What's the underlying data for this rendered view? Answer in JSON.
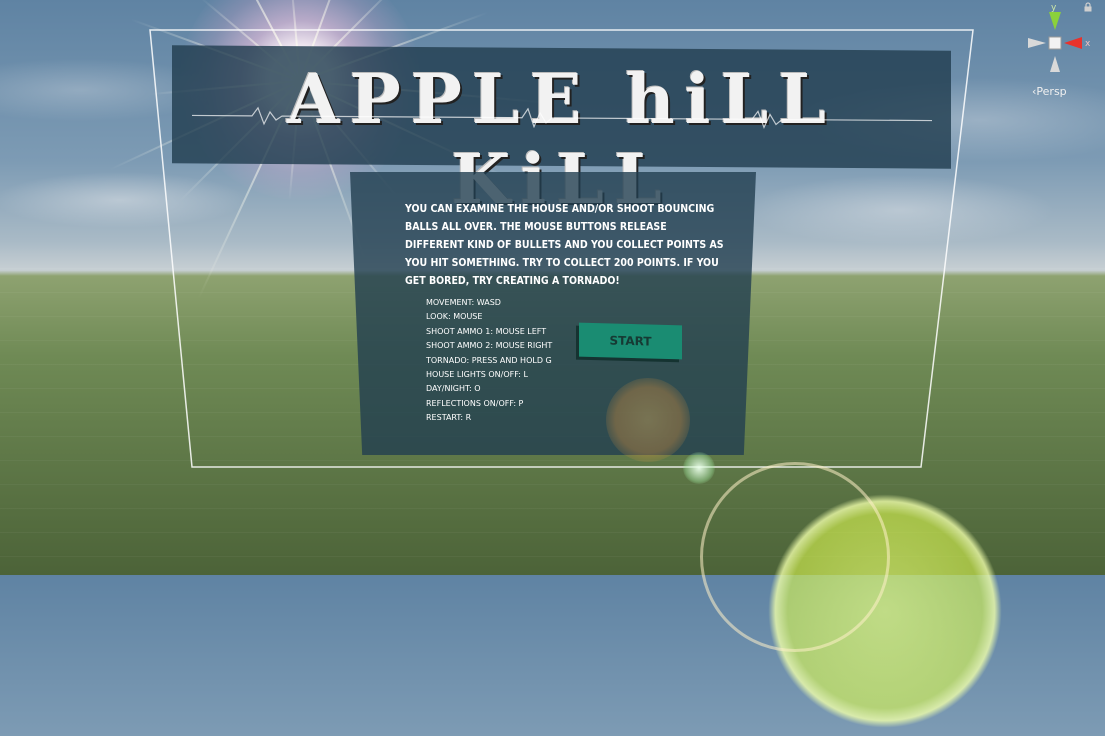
{
  "scene": {
    "title": "APPLE hiLL KiLL",
    "description": "YOU CAN EXAMINE THE HOUSE AND/OR SHOOT BOUNCING BALLS ALL OVER. THE MOUSE BUTTONS RELEASE DIFFERENT KIND OF BULLETS AND YOU COLLECT POINTS AS YOU HIT SOMETHING. TRY TO COLLECT 200 POINTS. IF YOU GET BORED, TRY CREATING A TORNADO!",
    "controls": [
      "MOVEMENT:    WASD",
      "LOOK:    MOUSE",
      "SHOOT AMMO 1: MOUSE LEFT",
      "SHOOT AMMO 2: MOUSE RIGHT",
      "TORNADO:    PRESS AND HOLD G",
      "HOUSE LIGHTS ON/OFF:    L",
      "DAY/NIGHT:    O",
      "REFLECTIONS ON/OFF:    P",
      "RESTART: R"
    ],
    "start_label": "START"
  },
  "gizmo": {
    "axis_y": "y",
    "axis_x": "x",
    "projection": "Persp",
    "colors": {
      "x": "#e8322c",
      "y": "#8bd13a",
      "z": "#3d5fe0"
    }
  },
  "colors": {
    "panel": "#223e50",
    "button": "#1a8c72"
  }
}
